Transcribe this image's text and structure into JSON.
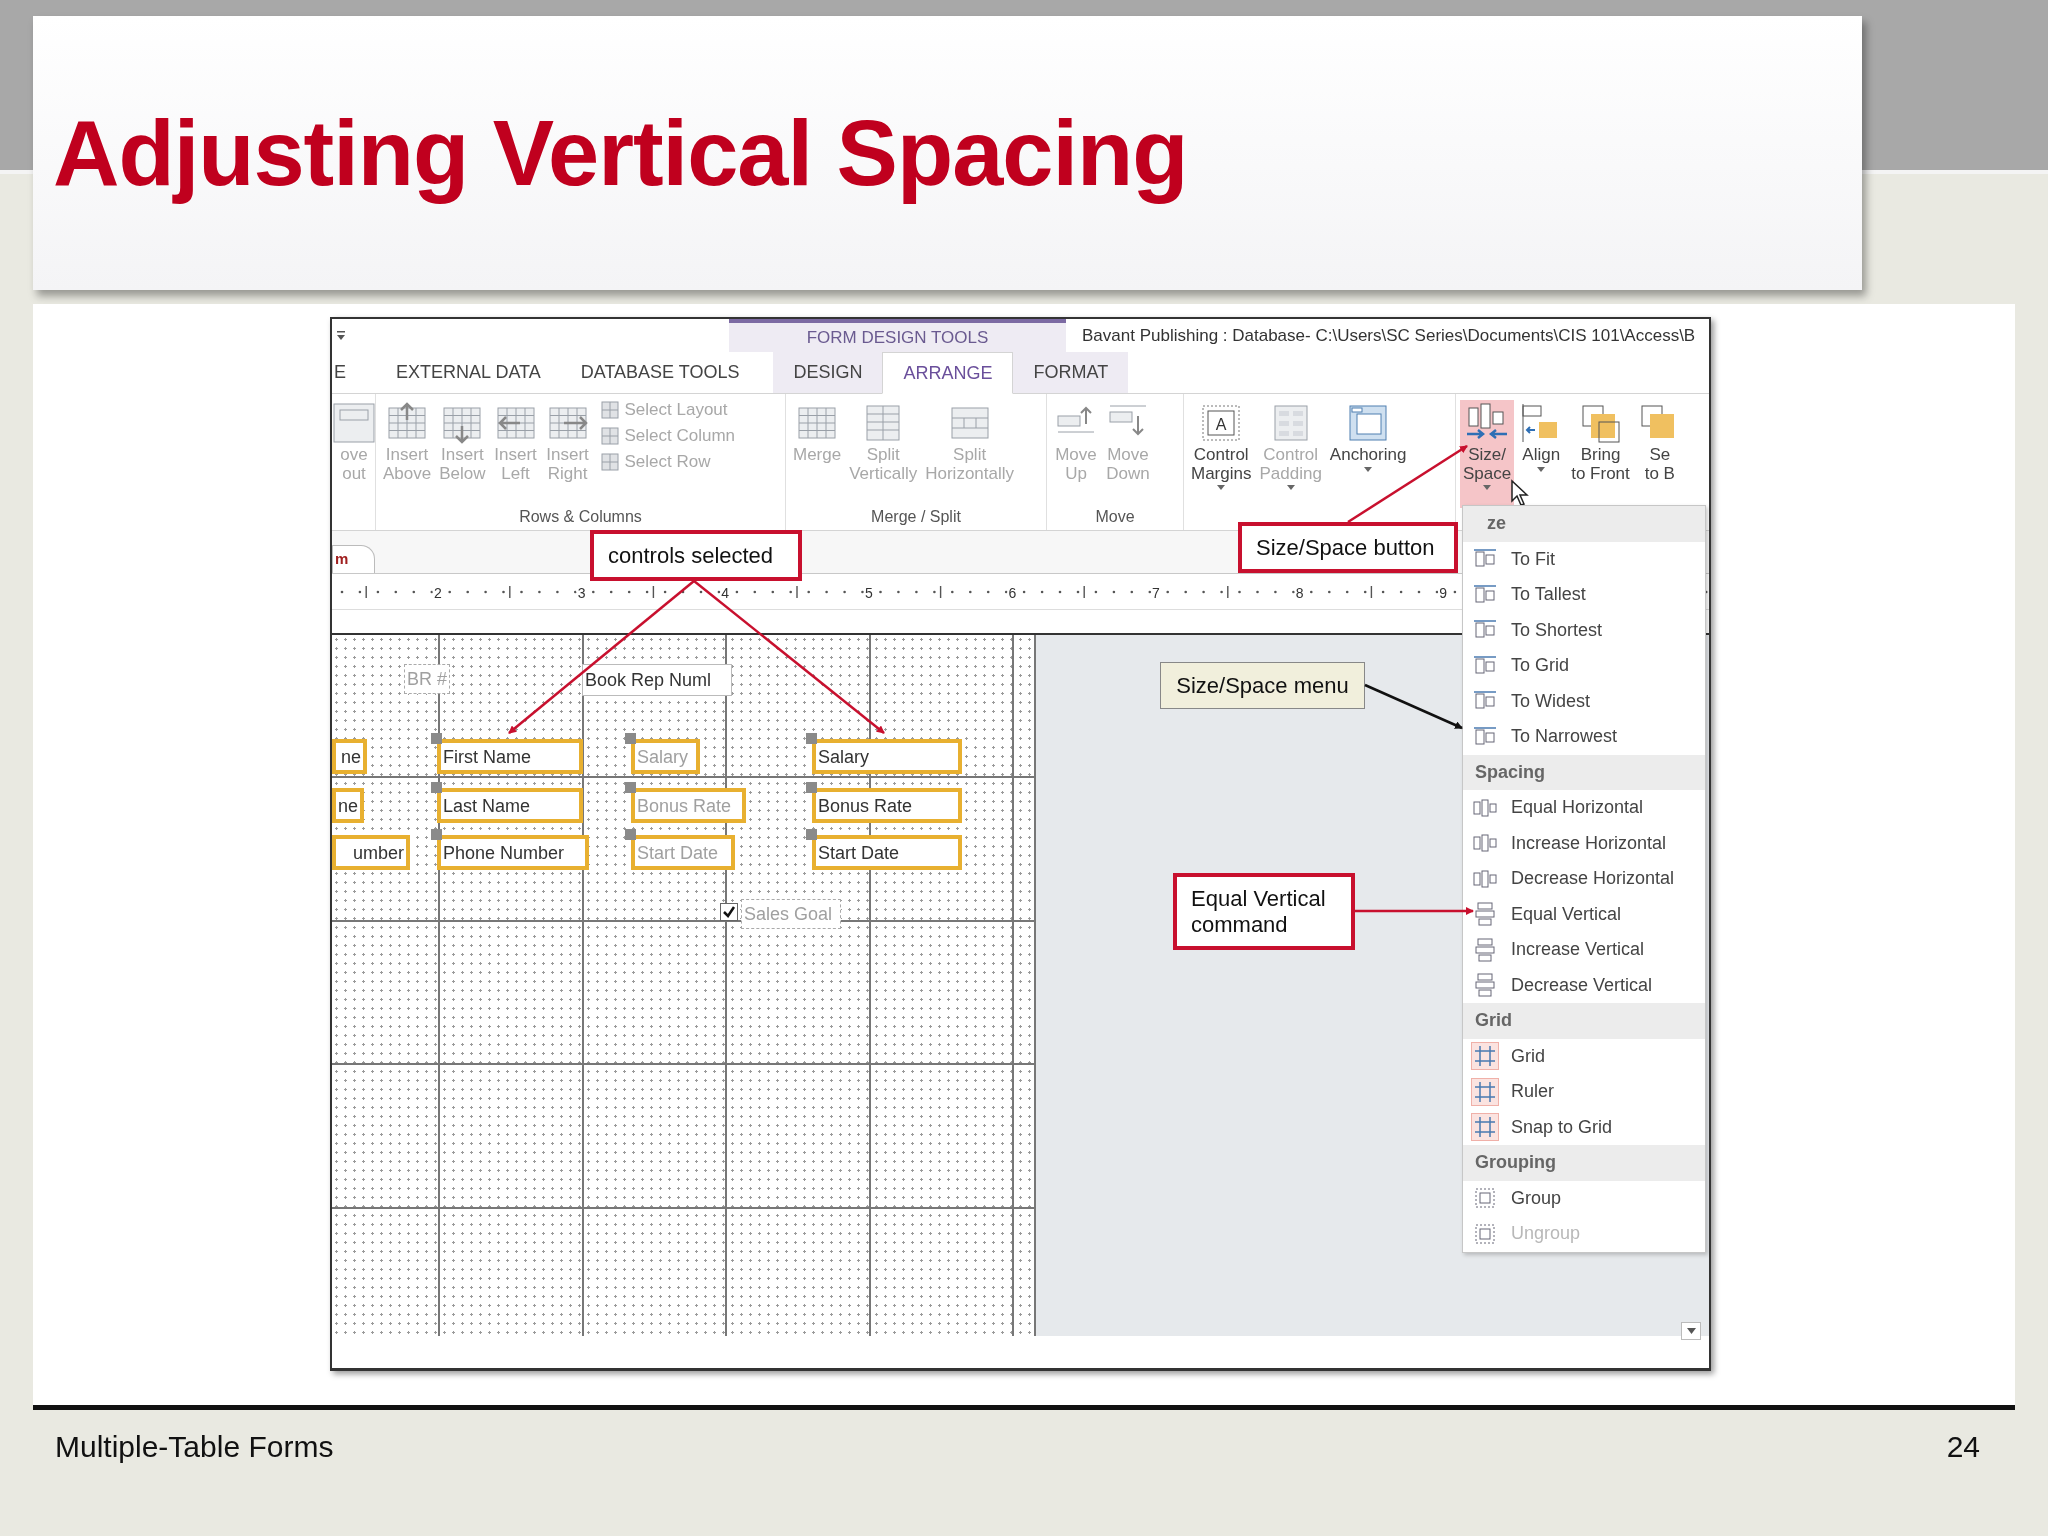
{
  "slide": {
    "title": "Adjusting Vertical Spacing",
    "footer": "Multiple-Table Forms",
    "page_number": "24"
  },
  "screenshot": {
    "context_group": "FORM DESIGN TOOLS",
    "title": "Bavant Publishing : Database- C:\\Users\\SC Series\\Documents\\CIS 101\\Access\\B",
    "tabs": [
      {
        "label": "E",
        "selected": false,
        "contextual": false
      },
      {
        "label": "EXTERNAL DATA",
        "selected": false,
        "contextual": false
      },
      {
        "label": "DATABASE TOOLS",
        "selected": false,
        "contextual": false
      },
      {
        "label": "DESIGN",
        "selected": false,
        "contextual": true
      },
      {
        "label": "ARRANGE",
        "selected": true,
        "contextual": true
      },
      {
        "label": "FORMAT",
        "selected": false,
        "contextual": true
      }
    ],
    "ribbon_groups": [
      {
        "buttons": [
          {
            "kind": "large",
            "label": "ove\nout",
            "disabled": true,
            "selected": false
          }
        ]
      },
      {
        "label": "Rows & Columns",
        "buttons": [
          {
            "kind": "large",
            "label": "Insert\nAbove",
            "disabled": true,
            "selected": false
          },
          {
            "kind": "large",
            "label": "Insert\nBelow",
            "disabled": true,
            "selected": false
          },
          {
            "kind": "large",
            "label": "Insert\nLeft",
            "disabled": true,
            "selected": false
          },
          {
            "kind": "large",
            "label": "Insert\nRight",
            "disabled": true,
            "selected": false
          },
          {
            "kind": "small",
            "label": "Select Layout",
            "disabled": true
          },
          {
            "kind": "small",
            "label": "Select Column",
            "disabled": true
          },
          {
            "kind": "small",
            "label": "Select Row",
            "disabled": true
          }
        ]
      },
      {
        "label": "Merge / Split",
        "buttons": [
          {
            "kind": "large",
            "label": "Merge",
            "disabled": true,
            "selected": false
          },
          {
            "kind": "large",
            "label": "Split\nVertically",
            "disabled": true,
            "selected": false
          },
          {
            "kind": "large",
            "label": "Split\nHorizontally",
            "disabled": true,
            "selected": false
          }
        ]
      },
      {
        "label": "Move",
        "buttons": [
          {
            "kind": "large",
            "label": "Move\nUp",
            "disabled": true,
            "selected": false
          },
          {
            "kind": "large",
            "label": "Move\nDown",
            "disabled": true,
            "selected": false
          }
        ]
      },
      {
        "buttons": [
          {
            "kind": "large",
            "label": "Control\nMargins",
            "glyph": "A",
            "dropdown": true,
            "disabled": false,
            "selected": false
          },
          {
            "kind": "large",
            "label": "Control\nPadding",
            "dropdown": true,
            "disabled": true,
            "selected": false
          },
          {
            "kind": "large",
            "label": "Anchoring",
            "dropdown": true,
            "disabled": false,
            "selected": false
          }
        ]
      },
      {
        "buttons": [
          {
            "kind": "large",
            "label": "Size/\nSpace",
            "dropdown": true,
            "disabled": false,
            "selected": true
          },
          {
            "kind": "large",
            "label": "Align",
            "dropdown": true,
            "disabled": false,
            "selected": false
          },
          {
            "kind": "large",
            "label": "Bring\nto Front",
            "disabled": false,
            "selected": false
          },
          {
            "kind": "large",
            "label": "Se\nto B",
            "disabled": false,
            "selected": false
          }
        ]
      }
    ],
    "document_tab": "m",
    "ruler_numbers": [
      "2",
      "3",
      "4",
      "5",
      "6",
      "7",
      "8",
      "9"
    ],
    "form_controls": [
      {
        "kind": "label",
        "text": "BR #",
        "selected": false
      },
      {
        "kind": "textbox",
        "text": "Book Rep Numl",
        "selected": false
      },
      {
        "kind": "textbox",
        "text": "ne",
        "selected": true
      },
      {
        "kind": "textbox",
        "text": "First Name",
        "selected": true
      },
      {
        "kind": "label",
        "text": "Salary",
        "selected": true
      },
      {
        "kind": "textbox",
        "text": "Salary",
        "selected": true
      },
      {
        "kind": "textbox",
        "text": "ne",
        "selected": true
      },
      {
        "kind": "textbox",
        "text": "Last Name",
        "selected": true
      },
      {
        "kind": "label",
        "text": "Bonus Rate",
        "selected": true
      },
      {
        "kind": "textbox",
        "text": "Bonus Rate",
        "selected": true
      },
      {
        "kind": "textbox",
        "text": "umber",
        "selected": true
      },
      {
        "kind": "textbox",
        "text": "Phone Number",
        "selected": true
      },
      {
        "kind": "label",
        "text": "Start Date",
        "selected": true
      },
      {
        "kind": "textbox",
        "text": "Start Date",
        "selected": true
      },
      {
        "kind": "label",
        "text": "Sales Goal",
        "selected": false
      }
    ],
    "checkbox": {
      "checked": true
    },
    "menu": [
      {
        "kind": "size",
        "header": "ze",
        "items": [
          {
            "label": "To Fit",
            "disabled": false,
            "checked": false
          },
          {
            "label": "To Tallest",
            "disabled": false,
            "checked": false
          },
          {
            "label": "To Shortest",
            "disabled": false,
            "checked": false
          },
          {
            "label": "To Grid",
            "disabled": false,
            "checked": false
          },
          {
            "label": "To Widest",
            "disabled": false,
            "checked": false
          },
          {
            "label": "To Narrowest",
            "disabled": false,
            "checked": false
          }
        ]
      },
      {
        "kind": "spacing",
        "header": "Spacing",
        "items": [
          {
            "label": "Equal Horizontal",
            "disabled": false,
            "checked": false
          },
          {
            "label": "Increase Horizontal",
            "disabled": false,
            "checked": false
          },
          {
            "label": "Decrease Horizontal",
            "disabled": false,
            "checked": false
          },
          {
            "label": "Equal Vertical",
            "disabled": false,
            "checked": false
          },
          {
            "label": "Increase Vertical",
            "disabled": false,
            "checked": false
          },
          {
            "label": "Decrease Vertical",
            "disabled": false,
            "checked": false
          }
        ]
      },
      {
        "kind": "grid",
        "header": "Grid",
        "items": [
          {
            "label": "Grid",
            "disabled": false,
            "checked": true
          },
          {
            "label": "Ruler",
            "disabled": false,
            "checked": true
          },
          {
            "label": "Snap to Grid",
            "disabled": false,
            "checked": true
          }
        ]
      },
      {
        "kind": "grouping",
        "header": "Grouping",
        "items": [
          {
            "label": "Group",
            "disabled": false,
            "checked": false
          },
          {
            "label": "Ungroup",
            "disabled": true,
            "checked": false
          }
        ]
      }
    ],
    "callouts": [
      {
        "kind": "red",
        "text": "controls selected"
      },
      {
        "kind": "red",
        "text": "Size/Space button"
      },
      {
        "kind": "plain",
        "text": "Size/Space menu"
      },
      {
        "kind": "red",
        "text": "Equal Vertical command"
      }
    ]
  }
}
